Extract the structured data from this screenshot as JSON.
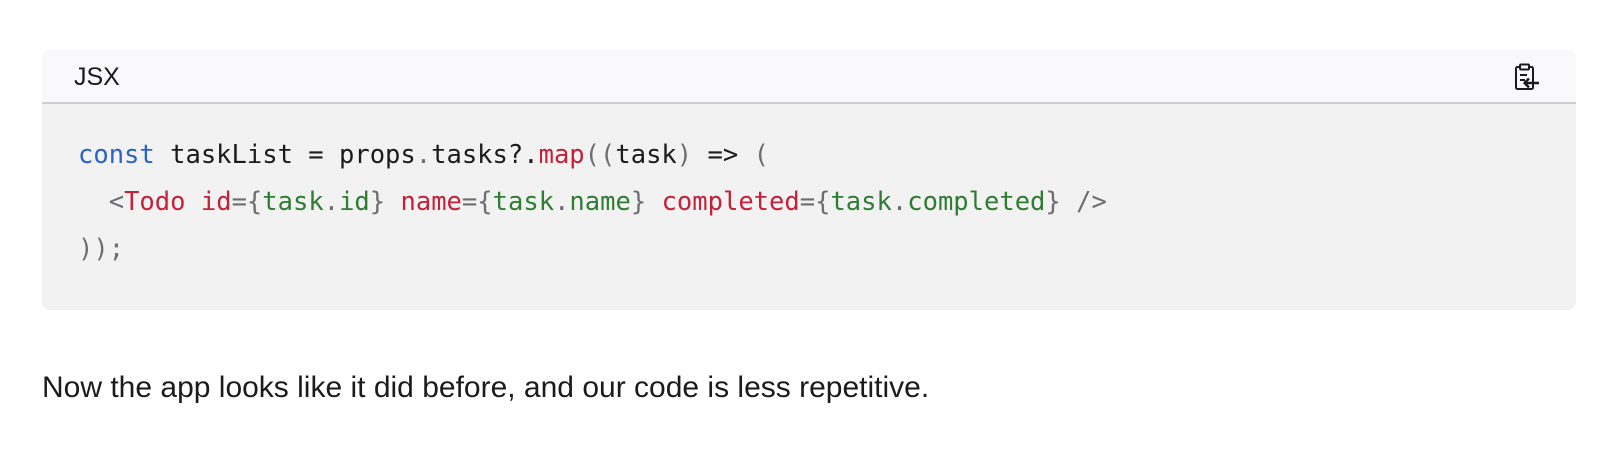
{
  "code_block": {
    "language_label": "JSX",
    "copy_icon": "clipboard-copy-icon",
    "lines": [
      [
        {
          "t": "const",
          "k": "kw"
        },
        {
          "t": " taskList = props",
          "k": "plain"
        },
        {
          "t": ".",
          "k": "punc"
        },
        {
          "t": "tasks?.",
          "k": "plain"
        },
        {
          "t": "map",
          "k": "fn"
        },
        {
          "t": "((",
          "k": "punc"
        },
        {
          "t": "task",
          "k": "plain"
        },
        {
          "t": ")",
          "k": "punc"
        },
        {
          "t": " => ",
          "k": "plain"
        },
        {
          "t": "(",
          "k": "punc"
        }
      ],
      [
        {
          "t": "  <",
          "k": "punc"
        },
        {
          "t": "Todo",
          "k": "tag"
        },
        {
          "t": " ",
          "k": "plain"
        },
        {
          "t": "id",
          "k": "attr"
        },
        {
          "t": "=",
          "k": "punc"
        },
        {
          "t": "{",
          "k": "punc"
        },
        {
          "t": "task",
          "k": "val"
        },
        {
          "t": ".",
          "k": "punc"
        },
        {
          "t": "id",
          "k": "val"
        },
        {
          "t": "}",
          "k": "punc"
        },
        {
          "t": " ",
          "k": "plain"
        },
        {
          "t": "name",
          "k": "attr"
        },
        {
          "t": "=",
          "k": "punc"
        },
        {
          "t": "{",
          "k": "punc"
        },
        {
          "t": "task",
          "k": "val"
        },
        {
          "t": ".",
          "k": "punc"
        },
        {
          "t": "name",
          "k": "val"
        },
        {
          "t": "}",
          "k": "punc"
        },
        {
          "t": " ",
          "k": "plain"
        },
        {
          "t": "completed",
          "k": "attr"
        },
        {
          "t": "=",
          "k": "punc"
        },
        {
          "t": "{",
          "k": "punc"
        },
        {
          "t": "task",
          "k": "val"
        },
        {
          "t": ".",
          "k": "punc"
        },
        {
          "t": "completed",
          "k": "val"
        },
        {
          "t": "}",
          "k": "punc"
        },
        {
          "t": " />",
          "k": "punc"
        }
      ],
      [
        {
          "t": "));",
          "k": "punc"
        }
      ]
    ]
  },
  "prose": {
    "text": "Now the app looks like it did before, and our code is less repetitive."
  },
  "colors": {
    "keyword": "#2b63c4",
    "function_tag_attr": "#c4213b",
    "value": "#2e7d32",
    "punctuation": "#6e6e6e",
    "code_background": "#f2f2f2",
    "header_background": "#f9f9fb"
  }
}
